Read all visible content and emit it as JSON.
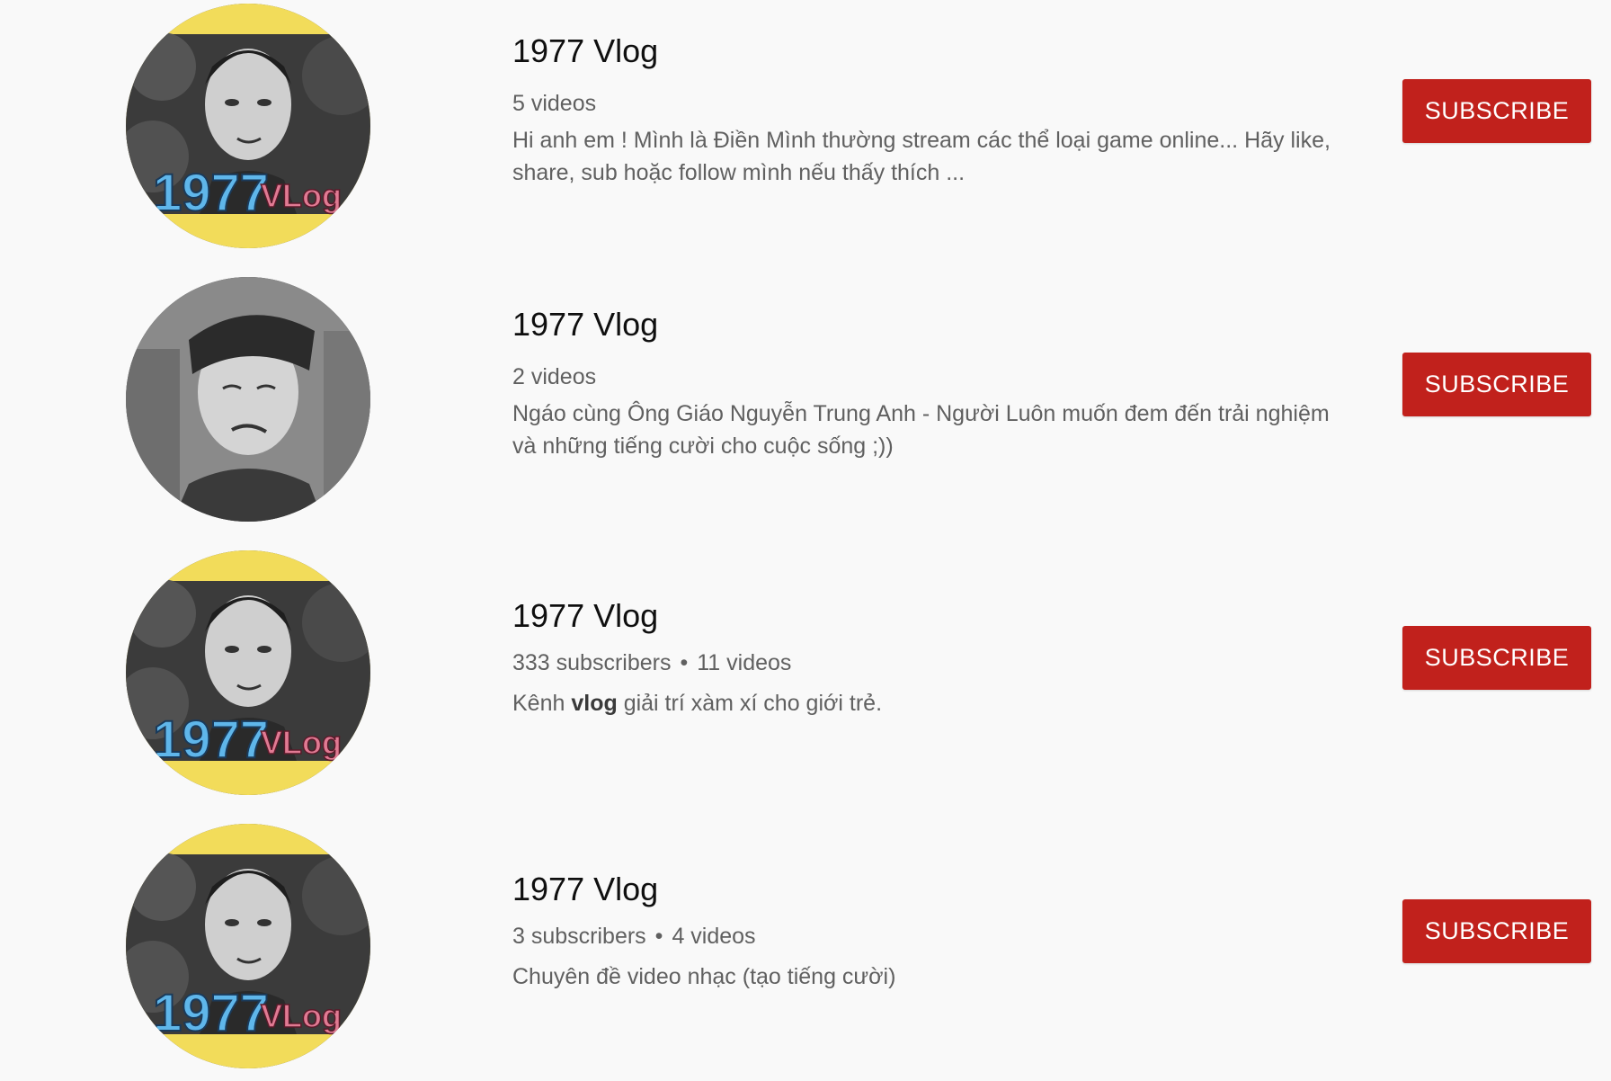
{
  "colors": {
    "background": "#f9f9f9",
    "subscribe_button": "#c1211c",
    "subscribe_text": "#ffffff",
    "title_text": "#0f0f0f",
    "meta_text": "#606060",
    "avatar_ring": "#f2dc5a",
    "logo_number": "#5fb6ea",
    "logo_vlog": "#e07a93"
  },
  "channels": [
    {
      "title": "1977 Vlog",
      "meta_videos": "5 videos",
      "description": "Hi anh em ! Mình là Điền Mình thường stream các thể loại game online... Hãy like, share, sub hoặc follow mình nếu thấy thích ...",
      "subscribe_label": "SUBSCRIBE",
      "avatar_logo": "1977 VLog",
      "avatar_icon": "channel-avatar-logo"
    },
    {
      "title": "1977 Vlog",
      "meta_videos": "2 videos",
      "description": "Ngáo cùng Ông Giáo Nguyễn Trung Anh - Người Luôn muốn đem đến trải nghiệm và những tiếng cười cho cuộc sống ;))",
      "subscribe_label": "SUBSCRIBE",
      "avatar_icon": "channel-avatar-photo"
    },
    {
      "title": "1977 Vlog",
      "meta_subscribers": "333 subscribers",
      "meta_separator": "•",
      "meta_videos": "11 videos",
      "description_before": "Kênh ",
      "description_bold": "vlog",
      "description_after": " giải trí xàm xí cho giới trẻ.",
      "subscribe_label": "SUBSCRIBE",
      "avatar_logo": "1977 VLog",
      "avatar_icon": "channel-avatar-logo"
    },
    {
      "title": "1977 Vlog",
      "meta_subscribers": "3 subscribers",
      "meta_separator": "•",
      "meta_videos": "4 videos",
      "description": "Chuyên đề video nhạc (tạo tiếng cười)",
      "subscribe_label": "SUBSCRIBE",
      "avatar_logo": "1977 VLog",
      "avatar_icon": "channel-avatar-logo"
    }
  ]
}
